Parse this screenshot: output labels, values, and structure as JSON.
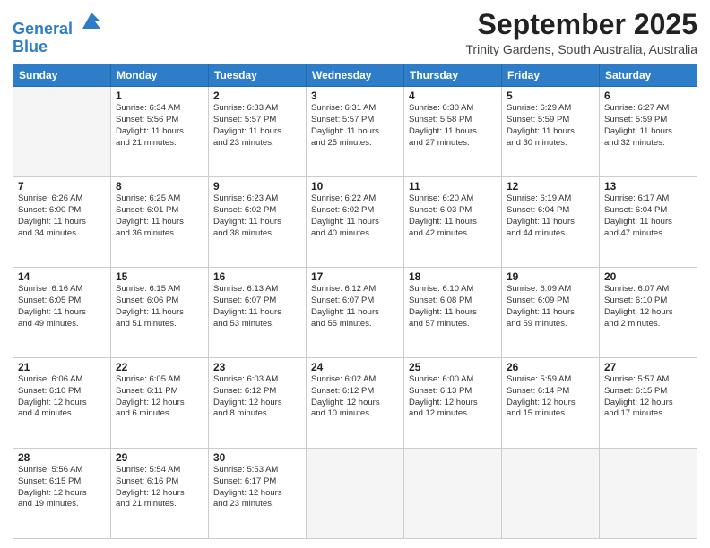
{
  "header": {
    "logo_line1": "General",
    "logo_line2": "Blue",
    "month": "September 2025",
    "location": "Trinity Gardens, South Australia, Australia"
  },
  "days": [
    "Sunday",
    "Monday",
    "Tuesday",
    "Wednesday",
    "Thursday",
    "Friday",
    "Saturday"
  ],
  "weeks": [
    [
      {
        "day": "",
        "info": ""
      },
      {
        "day": "1",
        "info": "Sunrise: 6:34 AM\nSunset: 5:56 PM\nDaylight: 11 hours\nand 21 minutes."
      },
      {
        "day": "2",
        "info": "Sunrise: 6:33 AM\nSunset: 5:57 PM\nDaylight: 11 hours\nand 23 minutes."
      },
      {
        "day": "3",
        "info": "Sunrise: 6:31 AM\nSunset: 5:57 PM\nDaylight: 11 hours\nand 25 minutes."
      },
      {
        "day": "4",
        "info": "Sunrise: 6:30 AM\nSunset: 5:58 PM\nDaylight: 11 hours\nand 27 minutes."
      },
      {
        "day": "5",
        "info": "Sunrise: 6:29 AM\nSunset: 5:59 PM\nDaylight: 11 hours\nand 30 minutes."
      },
      {
        "day": "6",
        "info": "Sunrise: 6:27 AM\nSunset: 5:59 PM\nDaylight: 11 hours\nand 32 minutes."
      }
    ],
    [
      {
        "day": "7",
        "info": "Sunrise: 6:26 AM\nSunset: 6:00 PM\nDaylight: 11 hours\nand 34 minutes."
      },
      {
        "day": "8",
        "info": "Sunrise: 6:25 AM\nSunset: 6:01 PM\nDaylight: 11 hours\nand 36 minutes."
      },
      {
        "day": "9",
        "info": "Sunrise: 6:23 AM\nSunset: 6:02 PM\nDaylight: 11 hours\nand 38 minutes."
      },
      {
        "day": "10",
        "info": "Sunrise: 6:22 AM\nSunset: 6:02 PM\nDaylight: 11 hours\nand 40 minutes."
      },
      {
        "day": "11",
        "info": "Sunrise: 6:20 AM\nSunset: 6:03 PM\nDaylight: 11 hours\nand 42 minutes."
      },
      {
        "day": "12",
        "info": "Sunrise: 6:19 AM\nSunset: 6:04 PM\nDaylight: 11 hours\nand 44 minutes."
      },
      {
        "day": "13",
        "info": "Sunrise: 6:17 AM\nSunset: 6:04 PM\nDaylight: 11 hours\nand 47 minutes."
      }
    ],
    [
      {
        "day": "14",
        "info": "Sunrise: 6:16 AM\nSunset: 6:05 PM\nDaylight: 11 hours\nand 49 minutes."
      },
      {
        "day": "15",
        "info": "Sunrise: 6:15 AM\nSunset: 6:06 PM\nDaylight: 11 hours\nand 51 minutes."
      },
      {
        "day": "16",
        "info": "Sunrise: 6:13 AM\nSunset: 6:07 PM\nDaylight: 11 hours\nand 53 minutes."
      },
      {
        "day": "17",
        "info": "Sunrise: 6:12 AM\nSunset: 6:07 PM\nDaylight: 11 hours\nand 55 minutes."
      },
      {
        "day": "18",
        "info": "Sunrise: 6:10 AM\nSunset: 6:08 PM\nDaylight: 11 hours\nand 57 minutes."
      },
      {
        "day": "19",
        "info": "Sunrise: 6:09 AM\nSunset: 6:09 PM\nDaylight: 11 hours\nand 59 minutes."
      },
      {
        "day": "20",
        "info": "Sunrise: 6:07 AM\nSunset: 6:10 PM\nDaylight: 12 hours\nand 2 minutes."
      }
    ],
    [
      {
        "day": "21",
        "info": "Sunrise: 6:06 AM\nSunset: 6:10 PM\nDaylight: 12 hours\nand 4 minutes."
      },
      {
        "day": "22",
        "info": "Sunrise: 6:05 AM\nSunset: 6:11 PM\nDaylight: 12 hours\nand 6 minutes."
      },
      {
        "day": "23",
        "info": "Sunrise: 6:03 AM\nSunset: 6:12 PM\nDaylight: 12 hours\nand 8 minutes."
      },
      {
        "day": "24",
        "info": "Sunrise: 6:02 AM\nSunset: 6:12 PM\nDaylight: 12 hours\nand 10 minutes."
      },
      {
        "day": "25",
        "info": "Sunrise: 6:00 AM\nSunset: 6:13 PM\nDaylight: 12 hours\nand 12 minutes."
      },
      {
        "day": "26",
        "info": "Sunrise: 5:59 AM\nSunset: 6:14 PM\nDaylight: 12 hours\nand 15 minutes."
      },
      {
        "day": "27",
        "info": "Sunrise: 5:57 AM\nSunset: 6:15 PM\nDaylight: 12 hours\nand 17 minutes."
      }
    ],
    [
      {
        "day": "28",
        "info": "Sunrise: 5:56 AM\nSunset: 6:15 PM\nDaylight: 12 hours\nand 19 minutes."
      },
      {
        "day": "29",
        "info": "Sunrise: 5:54 AM\nSunset: 6:16 PM\nDaylight: 12 hours\nand 21 minutes."
      },
      {
        "day": "30",
        "info": "Sunrise: 5:53 AM\nSunset: 6:17 PM\nDaylight: 12 hours\nand 23 minutes."
      },
      {
        "day": "",
        "info": ""
      },
      {
        "day": "",
        "info": ""
      },
      {
        "day": "",
        "info": ""
      },
      {
        "day": "",
        "info": ""
      }
    ]
  ]
}
